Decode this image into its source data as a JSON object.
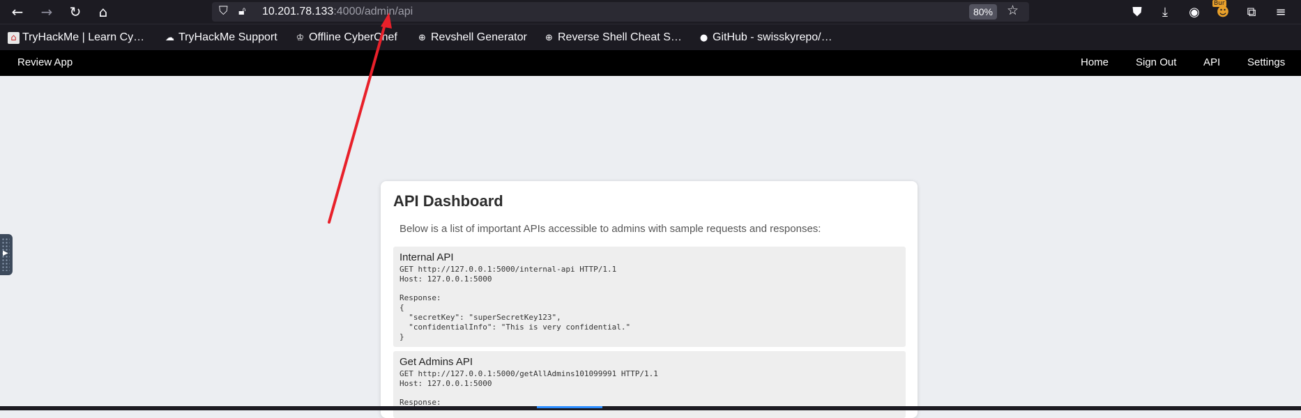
{
  "browser": {
    "url_host": "10.201.78.133",
    "url_path": ":4000/admin/api",
    "zoom": "80%",
    "icons": [
      "back-icon",
      "forward-icon",
      "reload-icon",
      "home-icon",
      "shield-icon",
      "insecure-lock-icon",
      "bookmark-star-icon",
      "pocket-icon",
      "download-icon",
      "account-icon",
      "burp-extension-icon",
      "extensions-icon",
      "menu-icon"
    ],
    "burp_badge": "Bur",
    "accent_color": "#e22850"
  },
  "bookmarks": [
    {
      "label": "TryHackMe | Learn Cy…",
      "icon": "tryhackme-icon"
    },
    {
      "label": "TryHackMe Support",
      "icon": "cloud-icon"
    },
    {
      "label": "Offline CyberChef",
      "icon": "chef-hat-icon"
    },
    {
      "label": "Revshell Generator",
      "icon": "globe-icon"
    },
    {
      "label": "Reverse Shell Cheat S…",
      "icon": "globe-icon"
    },
    {
      "label": "GitHub - swisskyrepo/…",
      "icon": "github-icon"
    }
  ],
  "navbar": {
    "brand": "Review App",
    "links": [
      "Home",
      "Sign Out",
      "API",
      "Settings"
    ]
  },
  "dashboard": {
    "title": "API Dashboard",
    "description": "Below is a list of important APIs accessible to admins with sample requests and responses:",
    "apis": [
      {
        "name": "Internal API",
        "request": "GET http://127.0.0.1:5000/internal-api HTTP/1.1\nHost: 127.0.0.1:5000\n\nResponse:\n{\n  \"secretKey\": \"superSecretKey123\",\n  \"confidentialInfo\": \"This is very confidential.\"\n}"
      },
      {
        "name": "Get Admins API",
        "request": "GET http://127.0.0.1:5000/getAllAdmins101099991 HTTP/1.1\nHost: 127.0.0.1:5000\n\nResponse:"
      }
    ]
  },
  "annotation": {
    "color": "#e8202a"
  }
}
